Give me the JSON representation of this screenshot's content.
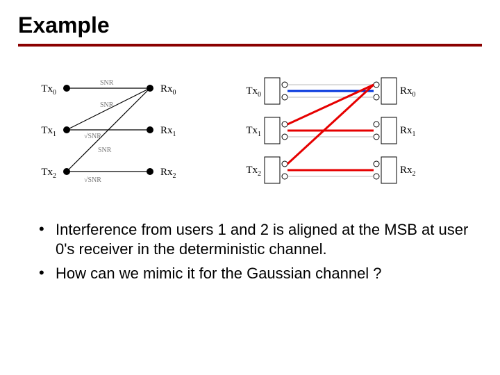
{
  "slide": {
    "title": "Example"
  },
  "left_diagram": {
    "tx_labels": [
      "Tx",
      "Tx",
      "Tx"
    ],
    "tx_subs": [
      "0",
      "1",
      "2"
    ],
    "rx_labels": [
      "Rx",
      "Rx",
      "Rx"
    ],
    "rx_subs": [
      "0",
      "1",
      "2"
    ],
    "edge_labels": {
      "e00": "SNR",
      "e10": "SNR",
      "e11": "√SNR",
      "e20": "SNR",
      "e22": "√SNR"
    }
  },
  "right_diagram": {
    "tx_labels": [
      "Tx",
      "Tx",
      "Tx"
    ],
    "tx_subs": [
      "0",
      "1",
      "2"
    ],
    "rx_labels": [
      "Rx",
      "Rx",
      "Rx"
    ],
    "rx_subs": [
      "0",
      "1",
      "2"
    ]
  },
  "bullets": [
    "Interference from users 1 and 2 is aligned at the MSB at user 0's receiver in the deterministic channel.",
    "How can we mimic it for the Gaussian channel ?"
  ],
  "bullet_marker": "•"
}
